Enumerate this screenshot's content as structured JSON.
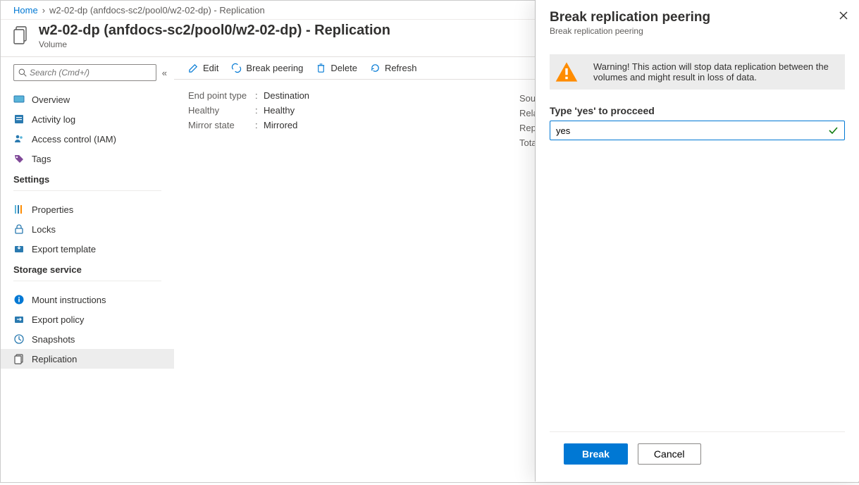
{
  "breadcrumb": {
    "home": "Home",
    "current": "w2-02-dp (anfdocs-sc2/pool0/w2-02-dp) - Replication"
  },
  "header": {
    "title": "w2-02-dp (anfdocs-sc2/pool0/w2-02-dp) - Replication",
    "subtitle": "Volume"
  },
  "search": {
    "placeholder": "Search (Cmd+/)"
  },
  "nav": {
    "items": [
      {
        "label": "Overview"
      },
      {
        "label": "Activity log"
      },
      {
        "label": "Access control (IAM)"
      },
      {
        "label": "Tags"
      }
    ],
    "settings_title": "Settings",
    "settings_items": [
      {
        "label": "Properties"
      },
      {
        "label": "Locks"
      },
      {
        "label": "Export template"
      }
    ],
    "storage_title": "Storage service",
    "storage_items": [
      {
        "label": "Mount instructions"
      },
      {
        "label": "Export policy"
      },
      {
        "label": "Snapshots"
      },
      {
        "label": "Replication"
      }
    ]
  },
  "toolbar": {
    "edit": "Edit",
    "break": "Break peering",
    "delete": "Delete",
    "refresh": "Refresh"
  },
  "details": {
    "endpoint_label": "End point type",
    "endpoint_value": "Destination",
    "healthy_label": "Healthy",
    "healthy_value": "Healthy",
    "mirror_label": "Mirror state",
    "mirror_value": "Mirrored",
    "right": {
      "sou": "Sou",
      "rela": "Rela",
      "rep": "Rep",
      "tota": "Tota"
    }
  },
  "panel": {
    "title": "Break replication peering",
    "subtitle": "Break replication peering",
    "warning_text": "Warning! This action will stop data replication between the volumes and might result in loss of data.",
    "confirm_label": "Type 'yes' to procceed",
    "confirm_value": "yes",
    "break_btn": "Break",
    "cancel_btn": "Cancel"
  }
}
